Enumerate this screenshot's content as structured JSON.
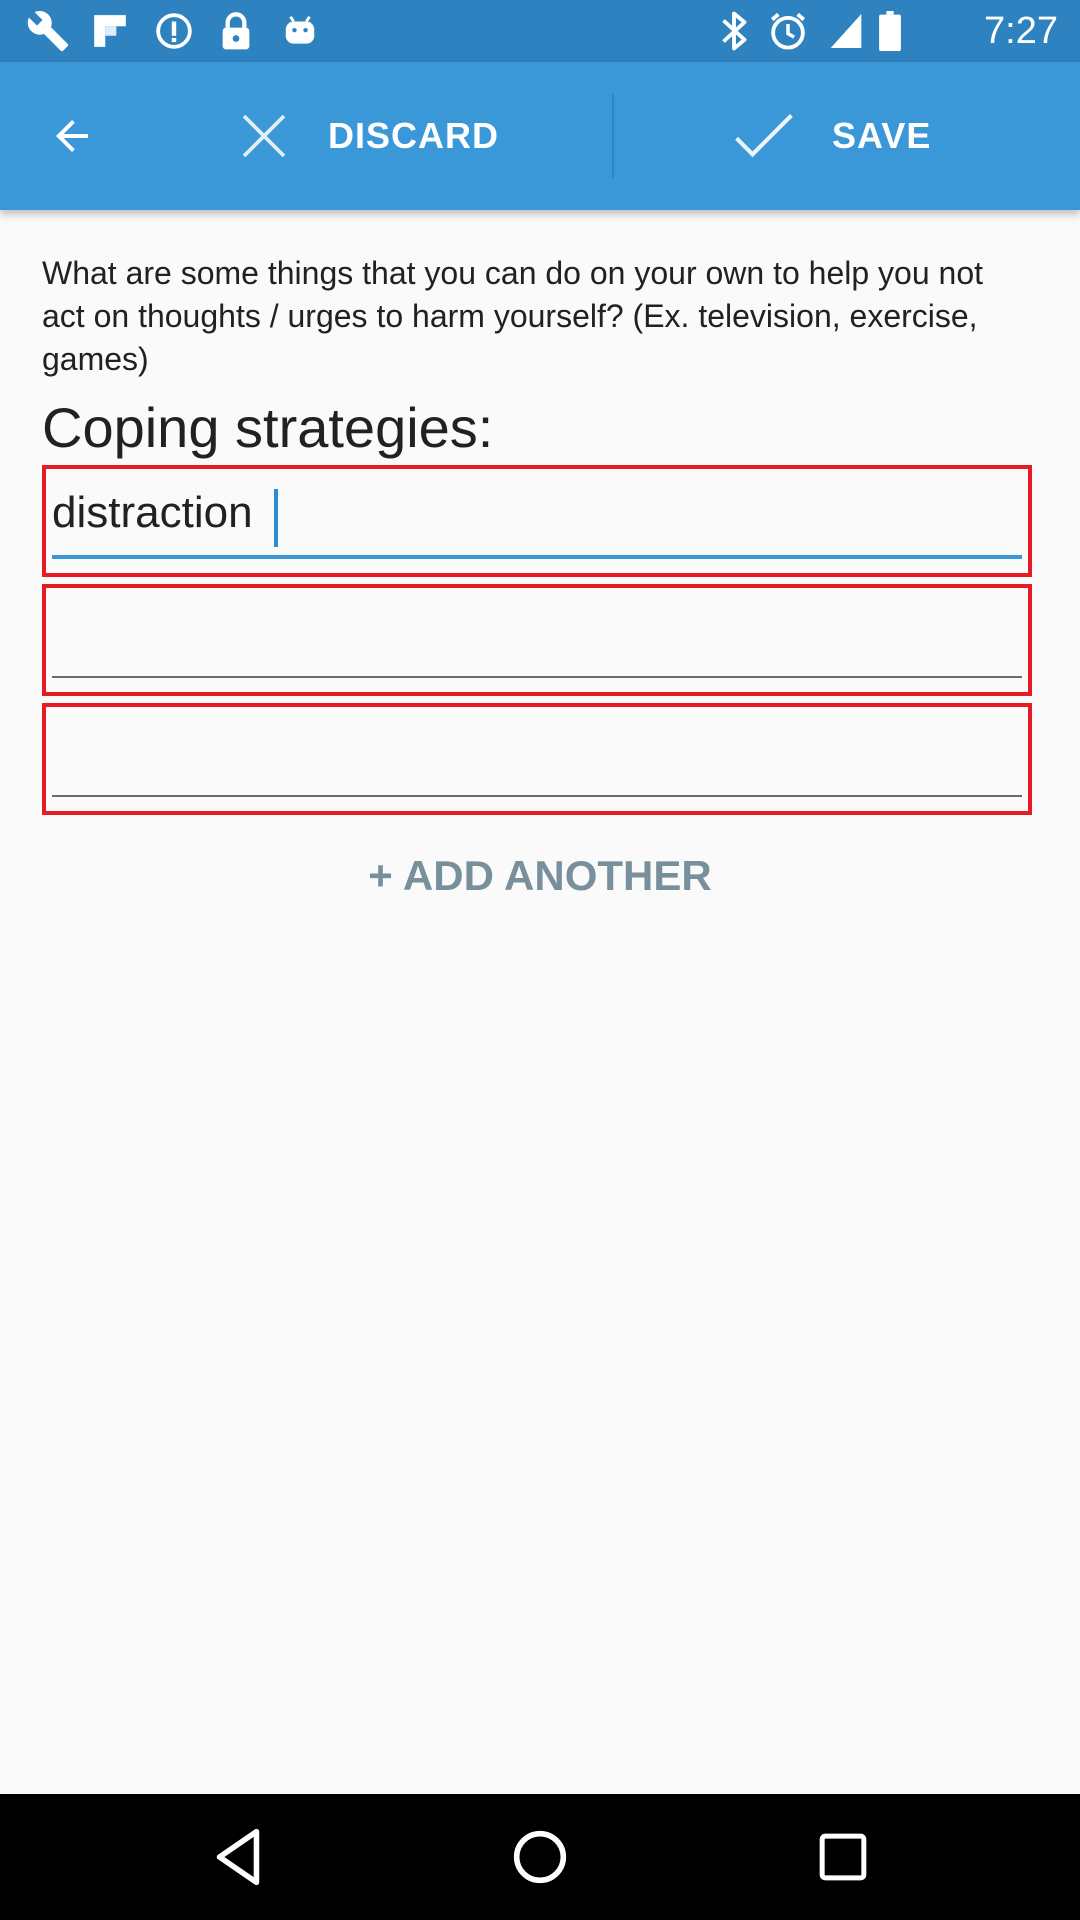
{
  "status_bar": {
    "time": "7:27",
    "left_icons": [
      "wrench-icon",
      "flipboard-icon",
      "info-icon",
      "lock-icon",
      "android-icon"
    ],
    "right_icons": [
      "bluetooth-icon",
      "alarm-icon"
    ]
  },
  "action_bar": {
    "discard_label": "DISCARD",
    "save_label": "SAVE",
    "color": "#3a98d8"
  },
  "form": {
    "question": "What are some things that you can do on your own to help you not act on thoughts / urges to harm yourself? (Ex. television, exercise, games)",
    "section_title": "Coping strategies:",
    "fields": [
      {
        "value": "distraction",
        "placeholder": ""
      },
      {
        "value": "",
        "placeholder": ""
      },
      {
        "value": "",
        "placeholder": ""
      }
    ],
    "add_another_label": "+ ADD ANOTHER"
  },
  "colors": {
    "status_bar": "#2f82c0",
    "action_bar": "#3a98d8",
    "highlight_border": "#e51c23",
    "add_another": "#78909c"
  },
  "nav_bar": {
    "buttons": [
      "back-triangle-icon",
      "home-circle-icon",
      "recents-square-icon"
    ]
  }
}
